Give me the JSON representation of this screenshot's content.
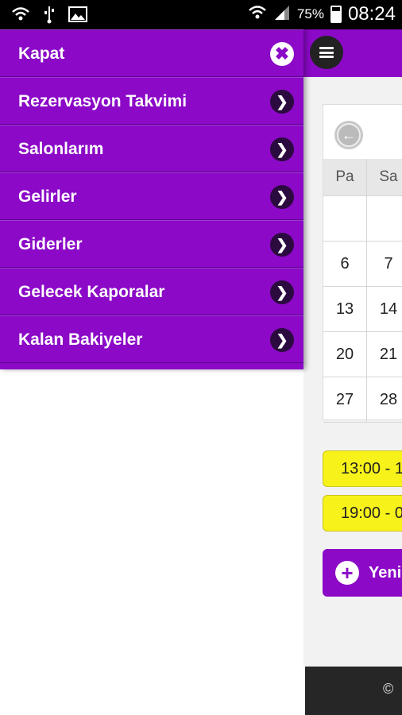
{
  "status_bar": {
    "battery_percent": "75%",
    "time": "08:24",
    "icons": [
      "wifi-icon",
      "usb-icon",
      "image-icon",
      "wifi-signal-icon",
      "cell-signal-icon",
      "battery-icon"
    ]
  },
  "drawer": {
    "close_label": "Kapat",
    "items": [
      {
        "label": "Rezervasyon Takvimi"
      },
      {
        "label": "Salonlarım"
      },
      {
        "label": "Gelirler"
      },
      {
        "label": "Giderler"
      },
      {
        "label": "Gelecek Kaporalar"
      },
      {
        "label": "Kalan Bakiyeler"
      }
    ]
  },
  "calendar": {
    "headers": [
      "Pa",
      "Sa"
    ],
    "rows": [
      [
        "",
        ""
      ],
      [
        "6",
        "7"
      ],
      [
        "13",
        "14"
      ],
      [
        "20",
        "21"
      ],
      [
        "27",
        "28"
      ]
    ]
  },
  "slots": [
    {
      "label": "13:00 - 1"
    },
    {
      "label": "19:00 - 0"
    }
  ],
  "new_button": {
    "label": "Yeni"
  },
  "footer": {
    "text": "©"
  },
  "colors": {
    "accent": "#8b09c7",
    "slot": "#f7f21a",
    "footer": "#262626"
  }
}
